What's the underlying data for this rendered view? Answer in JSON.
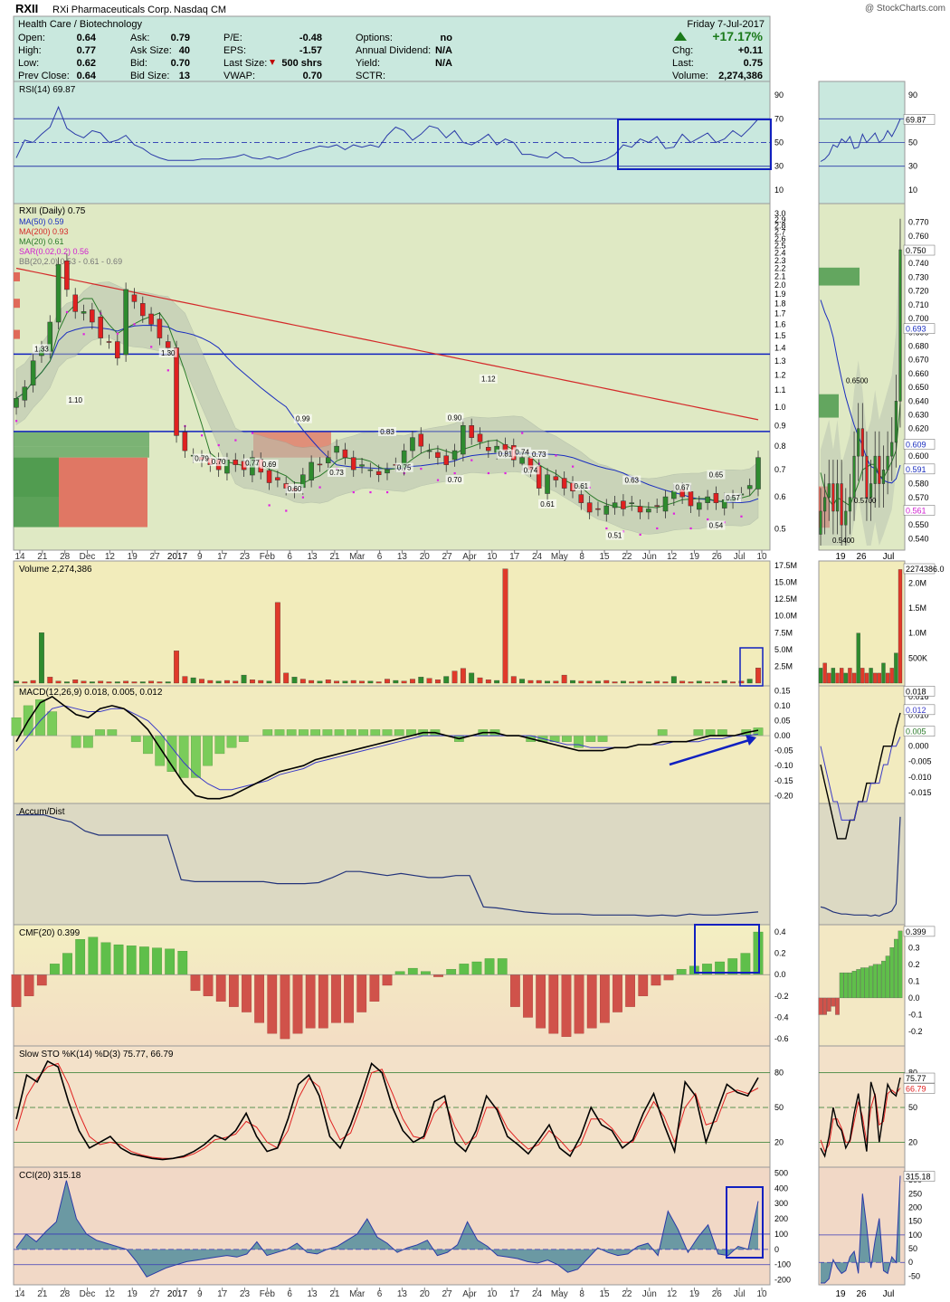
{
  "header": {
    "symbol": "RXII",
    "company": "RXi Pharmaceuticals Corp.",
    "exchange": "Nasdaq CM",
    "sector": "Health Care / Biotechnology",
    "date": "Friday   7-Jul-2017",
    "watermark": "@ StockCharts.com",
    "quote": {
      "open_label": "Open:",
      "open": "0.64",
      "high_label": "High:",
      "high": "0.77",
      "low_label": "Low:",
      "low": "0.62",
      "prev_label": "Prev Close:",
      "prev": "0.64",
      "ask_label": "Ask:",
      "ask": "0.79",
      "asksize_label": "Ask Size:",
      "asksize": "40",
      "bid_label": "Bid:",
      "bid": "0.70",
      "bidsize_label": "Bid Size:",
      "bidsize": "13",
      "pe_label": "P/E:",
      "pe": "-0.48",
      "eps_label": "EPS:",
      "eps": "-1.57",
      "lastsize_label": "Last Size:",
      "lastsize": "500 shrs",
      "vwap_label": "VWAP:",
      "vwap": "0.70",
      "options_label": "Options:",
      "options": "no",
      "div_label": "Annual Dividend:",
      "div": "N/A",
      "yield_label": "Yield:",
      "yield": "N/A",
      "sctr_label": "SCTR:",
      "sctr": "",
      "pct_change": "+17.17%",
      "chg_label": "Chg:",
      "chg": "+0.11",
      "last_label": "Last:",
      "last": "0.75",
      "volume_label": "Volume:",
      "volume": "2,274,386"
    }
  },
  "colors": {
    "up": "#2e8b2e",
    "down": "#e02020",
    "ma50": "#1a2ebf",
    "ma200": "#d42a2a",
    "ma20": "#2a7a2a",
    "sar": "#e020e0",
    "annotation": "#1020c0"
  },
  "chart_data": [
    {
      "type": "line",
      "panel": "RSI",
      "title": "RSI(14) 69.87",
      "y_ticks": [
        "90",
        "70",
        "50",
        "30",
        "10"
      ],
      "ylim": [
        0,
        100
      ],
      "reference_lines": [
        70,
        50,
        30
      ],
      "last_value": "69.87",
      "values": [
        37,
        52,
        50,
        57,
        63,
        80,
        62,
        57,
        54,
        60,
        58,
        50,
        52,
        56,
        48,
        45,
        40,
        37,
        35,
        35,
        35,
        35,
        36,
        36,
        36,
        37,
        38,
        40,
        37,
        36,
        38,
        36,
        38,
        41,
        43,
        45,
        47,
        46,
        48,
        44,
        48,
        46,
        48,
        46,
        56,
        63,
        60,
        52,
        57,
        64,
        62,
        54,
        60,
        50,
        48,
        52,
        57,
        48,
        53,
        50,
        40,
        40,
        38,
        37,
        42,
        37,
        37,
        33,
        33,
        34,
        36,
        40,
        48,
        46,
        53,
        50,
        55,
        45,
        46,
        57,
        50,
        54,
        58,
        50,
        53,
        60,
        55,
        62,
        69.87
      ]
    },
    {
      "type": "candlestick",
      "panel": "Price",
      "title": "RXII (Daily) 0.75",
      "legend": [
        "MA(50) 0.59",
        "MA(200) 0.93",
        "MA(20) 0.61",
        "SAR(0.02,0.2) 0.56",
        "BB(20,2.0) 0.53 - 0.61 - 0.69"
      ],
      "y_ticks": [
        "3.0",
        "2.9",
        "2.8",
        "2.7",
        "2.6",
        "2.5",
        "2.4",
        "2.3",
        "2.2",
        "2.1",
        "2.0",
        "1.9",
        "1.8",
        "1.7",
        "1.6",
        "1.5",
        "1.4",
        "1.3",
        "1.2",
        "1.1",
        "1.0",
        "0.9",
        "0.8",
        "0.7",
        "0.6",
        "0.5"
      ],
      "y_scale": "log",
      "ylim": [
        0.45,
        3.05
      ],
      "horizontal_lines": [
        1.35,
        0.87
      ],
      "x_labels": [
        "14",
        "21",
        "28",
        "Dec",
        "12",
        "19",
        "27",
        "2017",
        "9",
        "17",
        "23",
        "Feb",
        "6",
        "13",
        "21",
        "Mar",
        "6",
        "13",
        "20",
        "27",
        "Apr",
        "10",
        "17",
        "24",
        "May",
        "8",
        "15",
        "22",
        "Jun",
        "12",
        "19",
        "26",
        "Jul",
        "10"
      ],
      "annotations": [
        "1.33",
        "1.10",
        "1.30",
        "0.79",
        "0.70",
        "0.77",
        "0.69",
        "0.99",
        "0.60",
        "0.73",
        "0.83",
        "0.75",
        "0.90",
        "0.70",
        "1.12",
        "0.81",
        "0.74",
        "0.74",
        "0.73",
        "0.61",
        "0.61",
        "0.51",
        "0.63",
        "0.67",
        "0.65",
        "0.54",
        "0.57"
      ],
      "closes": [
        1.05,
        1.12,
        1.3,
        1.4,
        1.62,
        2.25,
        1.95,
        1.72,
        1.72,
        1.62,
        1.48,
        1.45,
        1.32,
        1.95,
        1.82,
        1.68,
        1.6,
        1.48,
        1.4,
        0.85,
        0.78,
        0.76,
        0.74,
        0.72,
        0.7,
        0.74,
        0.72,
        0.7,
        0.75,
        0.69,
        0.65,
        0.66,
        0.63,
        0.62,
        0.68,
        0.73,
        0.72,
        0.75,
        0.8,
        0.75,
        0.7,
        0.72,
        0.7,
        0.68,
        0.7,
        0.72,
        0.78,
        0.84,
        0.8,
        0.78,
        0.75,
        0.72,
        0.78,
        0.9,
        0.84,
        0.82,
        0.78,
        0.8,
        0.78,
        0.74,
        0.75,
        0.7,
        0.63,
        0.68,
        0.66,
        0.63,
        0.62,
        0.58,
        0.55,
        0.56,
        0.57,
        0.58,
        0.56,
        0.58,
        0.55,
        0.56,
        0.57,
        0.6,
        0.62,
        0.6,
        0.57,
        0.58,
        0.6,
        0.58,
        0.59,
        0.6,
        0.61,
        0.64,
        0.75
      ]
    },
    {
      "type": "bar",
      "panel": "Volume",
      "title": "Volume 2,274,386",
      "y_ticks": [
        "17.5M",
        "15.0M",
        "12.5M",
        "10.0M",
        "7.5M",
        "5.0M",
        "2.5M"
      ],
      "ylim": [
        0,
        17.5
      ],
      "unit": "M",
      "values": [
        0.3,
        0.2,
        0.4,
        7.5,
        0.9,
        0.3,
        0.2,
        0.5,
        0.3,
        0.2,
        0.3,
        0.2,
        0.2,
        0.3,
        0.2,
        0.2,
        0.3,
        0.2,
        0.2,
        4.8,
        1.0,
        0.8,
        0.6,
        0.4,
        0.3,
        0.4,
        0.3,
        1.2,
        0.5,
        0.4,
        0.3,
        12.0,
        1.5,
        0.9,
        0.6,
        0.4,
        0.3,
        0.5,
        0.3,
        0.3,
        0.4,
        0.3,
        0.3,
        0.2,
        0.6,
        0.4,
        0.3,
        0.6,
        0.9,
        0.7,
        0.5,
        1.0,
        1.8,
        2.2,
        1.5,
        0.8,
        0.5,
        0.4,
        17.0,
        1.0,
        0.6,
        0.4,
        0.4,
        0.3,
        0.3,
        1.2,
        0.4,
        0.3,
        0.3,
        0.3,
        0.4,
        0.2,
        0.3,
        0.2,
        0.3,
        0.2,
        0.3,
        0.2,
        1.0,
        0.3,
        0.2,
        0.3,
        0.2,
        0.2,
        0.4,
        0.2,
        0.3,
        0.6,
        2.27
      ]
    },
    {
      "type": "line",
      "panel": "MACD",
      "title": "MACD(12,26,9) 0.018, 0.005, 0.012",
      "y_ticks": [
        "0.15",
        "0.10",
        "0.05",
        "0.00",
        "-0.05",
        "-0.10",
        "-0.15",
        "-0.20"
      ],
      "ylim": [
        -0.22,
        0.16
      ],
      "series": [
        {
          "name": "MACD",
          "values": [
            -0.02,
            0.05,
            0.11,
            0.13,
            0.1,
            0.07,
            0.06,
            0.09,
            0.1,
            0.09,
            0.06,
            0.02,
            -0.04,
            -0.1,
            -0.16,
            -0.2,
            -0.21,
            -0.21,
            -0.2,
            -0.18,
            -0.16,
            -0.14,
            -0.12,
            -0.11,
            -0.1,
            -0.08,
            -0.07,
            -0.06,
            -0.05,
            -0.04,
            -0.03,
            -0.02,
            -0.01,
            0.0,
            0.01,
            0.01,
            0.0,
            -0.01,
            0.0,
            0.01,
            0.01,
            0.0,
            0.0,
            -0.01,
            -0.02,
            -0.03,
            -0.04,
            -0.05,
            -0.05,
            -0.05,
            -0.04,
            -0.04,
            -0.03,
            -0.03,
            -0.02,
            -0.02,
            -0.02,
            -0.01,
            0.0,
            0.0,
            0.0,
            0.01,
            0.018
          ]
        },
        {
          "name": "Signal",
          "values": [
            -0.05,
            0.0,
            0.05,
            0.09,
            0.1,
            0.09,
            0.08,
            0.08,
            0.09,
            0.09,
            0.07,
            0.05,
            0.01,
            -0.04,
            -0.09,
            -0.13,
            -0.16,
            -0.18,
            -0.18,
            -0.17,
            -0.16,
            -0.15,
            -0.13,
            -0.12,
            -0.11,
            -0.09,
            -0.08,
            -0.07,
            -0.06,
            -0.05,
            -0.04,
            -0.03,
            -0.02,
            -0.01,
            0.0,
            0.0,
            0.0,
            0.0,
            0.0,
            0.0,
            0.0,
            0.0,
            0.0,
            0.0,
            -0.01,
            -0.02,
            -0.03,
            -0.03,
            -0.04,
            -0.04,
            -0.04,
            -0.04,
            -0.03,
            -0.03,
            -0.03,
            -0.02,
            -0.02,
            -0.02,
            -0.01,
            -0.01,
            0.0,
            0.0,
            0.005
          ]
        }
      ]
    },
    {
      "type": "line",
      "panel": "Accum/Dist",
      "title": "Accum/Dist",
      "values": [
        10,
        10,
        10,
        9.6,
        9.3,
        8.4,
        8.0,
        8.0,
        8.0,
        8.0,
        8.0,
        8.0,
        3.6,
        3.4,
        3.4,
        3.4,
        3.4,
        3.4,
        3.4,
        3.2,
        3.2,
        3.2,
        3.3,
        3.8,
        4.4,
        4.4,
        4.2,
        4.0,
        4.2,
        4.0,
        3.8,
        3.8,
        4.0,
        4.0,
        0.9,
        0.8,
        0.6,
        0.4,
        0.3,
        0.2,
        0.2,
        0.2,
        0.1,
        0.1,
        0.1,
        0.1,
        0.0,
        0.1,
        0.0,
        0.2,
        0.1,
        0.1,
        0.2,
        0.3,
        0.4
      ]
    },
    {
      "type": "bar",
      "panel": "CMF",
      "title": "CMF(20) 0.399",
      "y_ticks": [
        "0.4",
        "0.2",
        "0.0",
        "-0.2",
        "-0.4",
        "-0.6"
      ],
      "ylim": [
        -0.65,
        0.45
      ],
      "last_value": "0.399",
      "values": [
        -0.3,
        -0.2,
        -0.1,
        0.1,
        0.2,
        0.33,
        0.35,
        0.3,
        0.28,
        0.27,
        0.26,
        0.25,
        0.24,
        0.22,
        -0.15,
        -0.2,
        -0.25,
        -0.3,
        -0.35,
        -0.45,
        -0.55,
        -0.6,
        -0.55,
        -0.5,
        -0.5,
        -0.45,
        -0.45,
        -0.35,
        -0.25,
        -0.1,
        0.03,
        0.06,
        0.03,
        -0.02,
        0.05,
        0.1,
        0.12,
        0.15,
        0.15,
        -0.3,
        -0.4,
        -0.5,
        -0.55,
        -0.58,
        -0.55,
        -0.5,
        -0.45,
        -0.35,
        -0.3,
        -0.2,
        -0.1,
        -0.05,
        0.05,
        0.08,
        0.1,
        0.12,
        0.15,
        0.2,
        0.399
      ]
    },
    {
      "type": "line",
      "panel": "Slow STO",
      "title": "Slow STO %K(14) %D(3) 75.77, 66.79",
      "y_ticks": [
        "80",
        "50",
        "20"
      ],
      "ylim": [
        0,
        100
      ],
      "reference_lines": [
        80,
        50,
        20
      ],
      "series": [
        {
          "name": "%K",
          "values": [
            40,
            78,
            72,
            90,
            85,
            55,
            30,
            15,
            20,
            25,
            15,
            10,
            8,
            6,
            5,
            6,
            8,
            12,
            18,
            26,
            22,
            30,
            45,
            25,
            12,
            15,
            40,
            70,
            78,
            60,
            25,
            15,
            35,
            60,
            88,
            80,
            50,
            30,
            20,
            25,
            55,
            60,
            20,
            12,
            30,
            60,
            48,
            25,
            18,
            10,
            22,
            35,
            15,
            8,
            25,
            50,
            35,
            30,
            15,
            22,
            45,
            62,
            35,
            12,
            72,
            60,
            20,
            45,
            70,
            63,
            60,
            75.77
          ]
        },
        {
          "name": "%D",
          "values": [
            30,
            60,
            75,
            85,
            88,
            70,
            45,
            25,
            18,
            20,
            18,
            12,
            9,
            7,
            6,
            6,
            7,
            10,
            15,
            22,
            24,
            27,
            38,
            33,
            20,
            15,
            30,
            58,
            75,
            68,
            40,
            22,
            28,
            52,
            80,
            83,
            62,
            40,
            25,
            23,
            45,
            55,
            33,
            18,
            25,
            50,
            50,
            32,
            22,
            14,
            18,
            30,
            22,
            12,
            18,
            40,
            40,
            32,
            20,
            20,
            38,
            55,
            42,
            20,
            50,
            62,
            35,
            38,
            62,
            65,
            62,
            66.79
          ]
        }
      ]
    },
    {
      "type": "area",
      "panel": "CCI",
      "title": "CCI(20) 315.18",
      "y_ticks": [
        "500",
        "400",
        "300",
        "200",
        "100",
        "0",
        "-100",
        "-200"
      ],
      "ylim": [
        -220,
        520
      ],
      "reference_lines": [
        100,
        0,
        -100
      ],
      "last_value": "315.18",
      "values": [
        10,
        100,
        50,
        120,
        180,
        450,
        200,
        100,
        60,
        40,
        20,
        0,
        -80,
        -180,
        -150,
        -120,
        -100,
        -80,
        -70,
        -60,
        -50,
        -40,
        -50,
        -30,
        50,
        -40,
        -20,
        0,
        40,
        -20,
        -30,
        0,
        20,
        60,
        100,
        200,
        80,
        40,
        -20,
        10,
        30,
        60,
        -40,
        -20,
        30,
        180,
        60,
        20,
        -40,
        -50,
        -60,
        -80,
        -90,
        -70,
        -100,
        -150,
        -130,
        -60,
        10,
        -20,
        -40,
        -30,
        20,
        40,
        -40,
        250,
        130,
        -20,
        80,
        160,
        -30,
        -40,
        20,
        0,
        315.18
      ]
    }
  ],
  "right_panel": {
    "rsi_ticks": [
      "90",
      "70",
      "50",
      "30",
      "10"
    ],
    "rsi_last": "69.87",
    "price_ticks": [
      "0.770",
      "0.760",
      "0.750",
      "0.740",
      "0.730",
      "0.720",
      "0.710",
      "0.700",
      "0.690",
      "0.680",
      "0.670",
      "0.660",
      "0.650",
      "0.640",
      "0.630",
      "0.620",
      "0.610",
      "0.600",
      "0.590",
      "0.580",
      "0.570",
      "0.560",
      "0.550",
      "0.540"
    ],
    "price_labels": [
      "0.750",
      "0.693",
      "0.609",
      "0.591",
      "0.561"
    ],
    "price_annotations": [
      "0.6500",
      "0.5700",
      "0.5400"
    ],
    "volume_ticks": [
      "2.0M",
      "1.5M",
      "1.0M",
      "500K"
    ],
    "volume_label": "2274386.0",
    "macd_ticks": [
      "0.016",
      "0.010",
      "0.005",
      "0.000",
      "-0.005",
      "-0.010",
      "-0.015"
    ],
    "macd_labels": [
      "0.018",
      "0.012",
      "0.005"
    ],
    "cmf_ticks": [
      "0.3",
      "0.2",
      "0.1",
      "0.0",
      "-0.1",
      "-0.2"
    ],
    "cmf_label": "0.399",
    "sto_ticks": [
      "80",
      "50",
      "20"
    ],
    "sto_labels": [
      "75.77",
      "66.79"
    ],
    "cci_ticks": [
      "300",
      "250",
      "200",
      "150",
      "100",
      "50",
      "0",
      "-50"
    ],
    "cci_label": "315.18",
    "x_labels": [
      "19",
      "26",
      "Jul"
    ]
  }
}
